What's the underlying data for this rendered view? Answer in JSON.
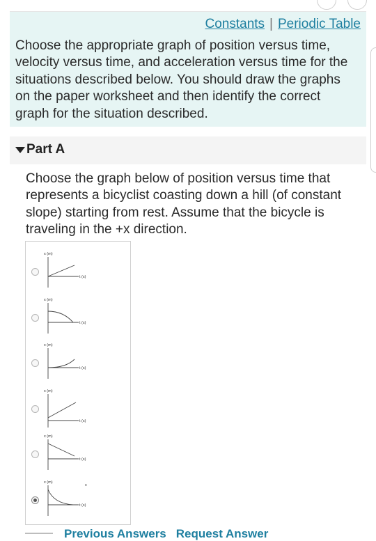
{
  "header": {
    "constants_link": "Constants",
    "separator": "|",
    "periodic_table_link": "Periodic Table"
  },
  "intro_text": "Choose the appropriate graph of position versus time, velocity versus time, and acceleration versus time for the situations described below. You should draw the graphs on the paper worksheet and then identify the correct graph for the situation described.",
  "part": {
    "title": "Part A",
    "question": "Choose the graph below of position versus time that represents a bicyclist coasting down a hill (of constant slope) starting from rest. Assume that the bicycle is traveling in the +x direction.",
    "choices": [
      {
        "x_label": "x (m)",
        "t_label": "t (s)",
        "selected": false,
        "shape": "linear-increasing"
      },
      {
        "x_label": "x (m)",
        "t_label": "t (s)",
        "selected": false,
        "shape": "concave-down-decreasing"
      },
      {
        "x_label": "x (m)",
        "t_label": "t (s)",
        "selected": false,
        "shape": "concave-up-increasing"
      },
      {
        "x_label": "x (m)",
        "t_label": "t (s)",
        "selected": false,
        "shape": "linear-decreasing"
      },
      {
        "x_label": "x (m)",
        "t_label": "t (s)",
        "selected": false,
        "shape": "concave-down-increasing"
      },
      {
        "x_label": "x (m)",
        "t_label": "t (s)",
        "selected": true,
        "shape": "concave-up-decreasing",
        "mark": "x"
      }
    ]
  },
  "footer": {
    "previous_answers": "Previous Answers",
    "request_answer": "Request Answer"
  },
  "colors": {
    "info_background": "#e6f5f4",
    "link": "#1e7fa0",
    "part_header_background": "#f4f4f4"
  }
}
